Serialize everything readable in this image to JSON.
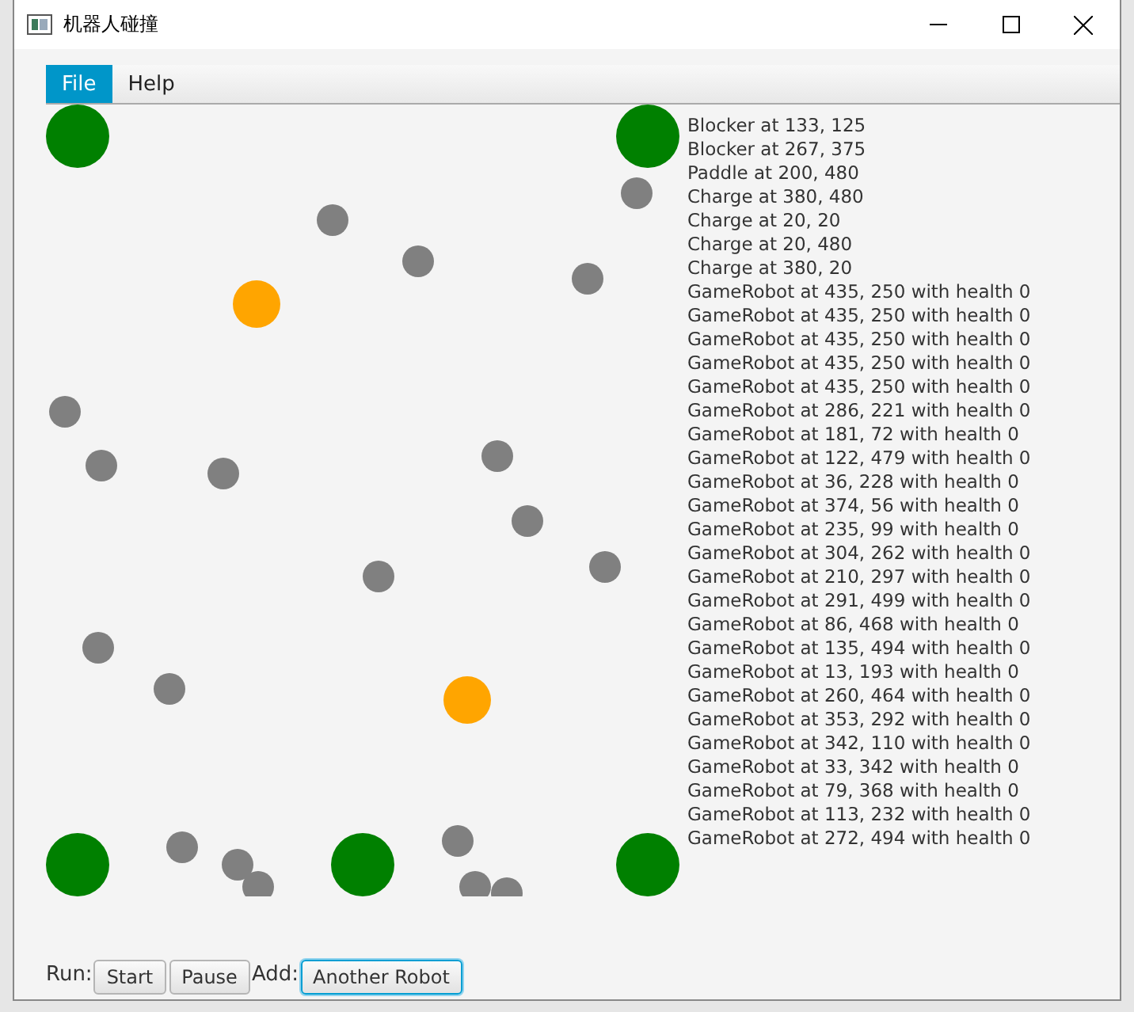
{
  "window": {
    "title": "机器人碰撞"
  },
  "menu": [
    {
      "label": "File",
      "selected": true
    },
    {
      "label": "Help",
      "selected": false
    }
  ],
  "arena": [
    {
      "kind": "charge"
    },
    {
      "kind": "charge"
    },
    {
      "kind": "charge"
    },
    {
      "kind": "paddle"
    },
    {
      "kind": "charge"
    },
    {
      "kind": "blocker"
    },
    {
      "kind": "blocker"
    },
    {
      "kind": "robot"
    },
    {
      "kind": "robot"
    },
    {
      "kind": "robot"
    },
    {
      "kind": "robot"
    },
    {
      "kind": "robot"
    },
    {
      "kind": "robot"
    },
    {
      "kind": "robot"
    },
    {
      "kind": "robot"
    },
    {
      "kind": "robot"
    },
    {
      "kind": "robot"
    },
    {
      "kind": "robot"
    },
    {
      "kind": "robot"
    },
    {
      "kind": "robot"
    },
    {
      "kind": "robot"
    },
    {
      "kind": "robot"
    },
    {
      "kind": "robot"
    },
    {
      "kind": "robot"
    },
    {
      "kind": "robot"
    },
    {
      "kind": "robot"
    }
  ],
  "log": [
    "Blocker at 133, 125",
    "Blocker at 267, 375",
    "Paddle at 200, 480",
    "Charge at 380, 480",
    "Charge at 20, 20",
    "Charge at 20, 480",
    "Charge at 380, 20",
    "GameRobot at 435, 250 with health 0",
    "GameRobot at 435, 250 with health 0",
    "GameRobot at 435, 250 with health 0",
    "GameRobot at 435, 250 with health 0",
    "GameRobot at 435, 250 with health 0",
    "GameRobot at 286, 221 with health 0",
    "GameRobot at 181, 72 with health 0",
    "GameRobot at 122, 479 with health 0",
    "GameRobot at 36, 228 with health 0",
    "GameRobot at 374, 56 with health 0",
    "GameRobot at 235, 99 with health 0",
    "GameRobot at 304, 262 with health 0",
    "GameRobot at 210, 297 with health 0",
    "GameRobot at 291, 499 with health 0",
    "GameRobot at 86, 468 with health 0",
    "GameRobot at 135, 494 with health 0",
    "GameRobot at 13, 193 with health 0",
    "GameRobot at 260, 464 with health 0",
    "GameRobot at 353, 292 with health 0",
    "GameRobot at 342, 110 with health 0",
    "GameRobot at 33, 342 with health 0",
    "GameRobot at 79, 368 with health 0",
    "GameRobot at 113, 232 with health 0",
    "GameRobot at 272, 494 with health 0"
  ],
  "controls": [
    {
      "kind": "label",
      "text": "Run:"
    },
    {
      "kind": "button",
      "text": "Start",
      "focused": false
    },
    {
      "kind": "button",
      "text": "Pause",
      "focused": false
    },
    {
      "kind": "label",
      "text": "Add:"
    },
    {
      "kind": "button",
      "text": "Another Robot",
      "focused": true
    }
  ]
}
